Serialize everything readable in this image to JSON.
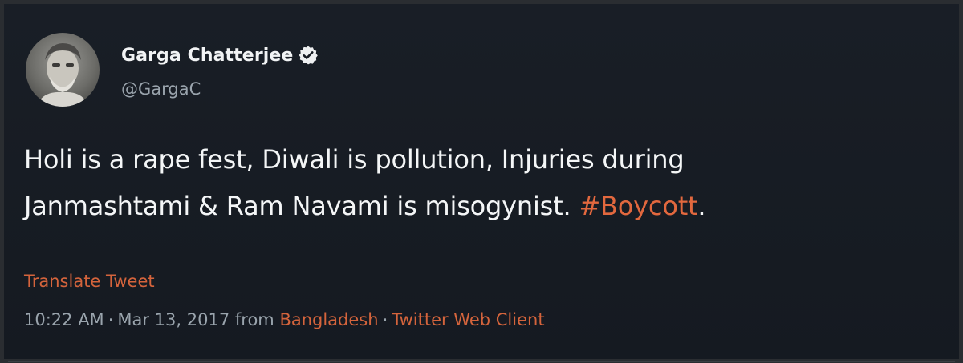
{
  "user": {
    "display_name": "Garga Chatterjee",
    "handle": "@GargaC",
    "verified_icon": "verified-badge-icon"
  },
  "tweet": {
    "text_line1": "Holi is a rape fest, Diwali is pollution, Injuries during",
    "text_line2": "Janmashtami & Ram Navami is misogynist.",
    "hashtag": "#Boycott",
    "trailing": "."
  },
  "translate_label": "Translate Tweet",
  "meta": {
    "time": "10:22 AM",
    "dot1": "·",
    "date": "Mar 13, 2017",
    "from": "from",
    "location": "Bangladesh",
    "dot2": "·",
    "client": "Twitter Web Client"
  },
  "colors": {
    "background": "#151a21",
    "link": "#d5643c",
    "secondary_text": "#9aa4ad",
    "primary_text": "#f4f6f7"
  }
}
